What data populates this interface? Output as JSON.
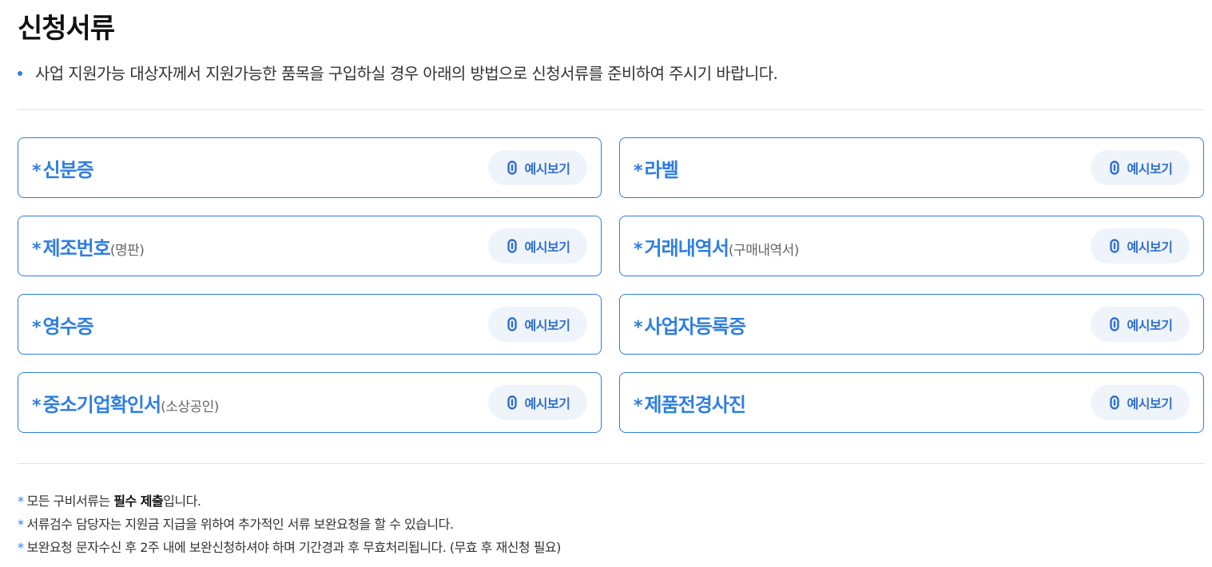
{
  "page": {
    "title": "신청서류",
    "intro": "사업 지원가능 대상자께서 지원가능한 품목을 구입하실 경우 아래의 방법으로 신청서류를 준비하여 주시기 바랍니다."
  },
  "documents": [
    {
      "star": "*",
      "title": "신분증",
      "sub": "",
      "button": "예시보기"
    },
    {
      "star": "*",
      "title": "라벨",
      "sub": "",
      "button": "예시보기"
    },
    {
      "star": "*",
      "title": "제조번호",
      "sub": "(명판)",
      "button": "예시보기"
    },
    {
      "star": "*",
      "title": "거래내역서",
      "sub": "(구매내역서)",
      "button": "예시보기"
    },
    {
      "star": "*",
      "title": "영수증",
      "sub": "",
      "button": "예시보기"
    },
    {
      "star": "*",
      "title": "사업자등록증",
      "sub": "",
      "button": "예시보기"
    },
    {
      "star": "*",
      "title": "중소기업확인서",
      "sub": "(소상공인)",
      "button": "예시보기"
    },
    {
      "star": "*",
      "title": "제품전경사진",
      "sub": "",
      "button": "예시보기"
    }
  ],
  "notes": [
    {
      "star": "*",
      "pre": "모든 구비서류는 ",
      "bold": "필수 제출",
      "post": "입니다."
    },
    {
      "star": "*",
      "pre": "서류검수 담당자는 지원금 지급을 위하여 추가적인 서류 보완요청을 할 수 있습니다.",
      "bold": "",
      "post": ""
    },
    {
      "star": "*",
      "pre": "보완요청 문자수신 후 2주 내에 보완신청하셔야 하며 기간경과 후 무효처리됩니다. (무효 후 재신청 필요)",
      "bold": "",
      "post": ""
    }
  ],
  "colors": {
    "accent": "#2f7ee0",
    "button_bg": "#eff4fb"
  },
  "icons": {
    "intro_bullet": "bullet-dot",
    "preview_button": "link-icon"
  }
}
